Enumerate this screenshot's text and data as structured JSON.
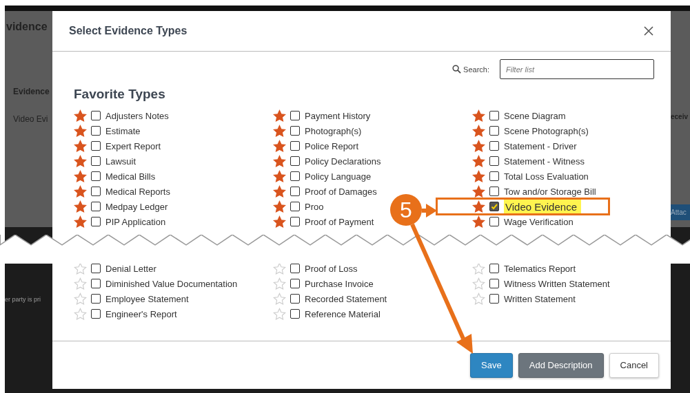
{
  "background": {
    "title": "vidence",
    "column_header": "Evidence",
    "cell": "Video Evi",
    "right_header": "eceiv",
    "right_button": "Attac",
    "note": "er party is pri"
  },
  "dialog": {
    "title": "Select Evidence Types",
    "search": {
      "label": "Search:",
      "placeholder": "Filter list"
    },
    "section_title": "Favorite Types",
    "favorite_columns": [
      [
        {
          "label": "Adjusters Notes",
          "favorite": true,
          "checked": false
        },
        {
          "label": "Estimate",
          "favorite": true,
          "checked": false
        },
        {
          "label": "Expert Report",
          "favorite": true,
          "checked": false
        },
        {
          "label": "Lawsuit",
          "favorite": true,
          "checked": false
        },
        {
          "label": "Medical Bills",
          "favorite": true,
          "checked": false
        },
        {
          "label": "Medical Reports",
          "favorite": true,
          "checked": false
        },
        {
          "label": "Medpay Ledger",
          "favorite": true,
          "checked": false
        },
        {
          "label": "PIP Application",
          "favorite": true,
          "checked": false
        }
      ],
      [
        {
          "label": "Payment History",
          "favorite": true,
          "checked": false
        },
        {
          "label": "Photograph(s)",
          "favorite": true,
          "checked": false
        },
        {
          "label": "Police Report",
          "favorite": true,
          "checked": false
        },
        {
          "label": "Policy Declarations",
          "favorite": true,
          "checked": false
        },
        {
          "label": "Policy Language",
          "favorite": true,
          "checked": false
        },
        {
          "label": "Proof of Damages",
          "favorite": true,
          "checked": false
        },
        {
          "label": "Proo",
          "favorite": true,
          "checked": false
        },
        {
          "label": "Proof of Payment",
          "favorite": true,
          "checked": false
        }
      ],
      [
        {
          "label": "Scene Diagram",
          "favorite": true,
          "checked": false
        },
        {
          "label": "Scene Photograph(s)",
          "favorite": true,
          "checked": false
        },
        {
          "label": "Statement - Driver",
          "favorite": true,
          "checked": false
        },
        {
          "label": "Statement - Witness",
          "favorite": true,
          "checked": false
        },
        {
          "label": "Total Loss Evaluation",
          "favorite": true,
          "checked": false
        },
        {
          "label": "Tow and/or Storage Bill",
          "favorite": true,
          "checked": false
        },
        {
          "label": "Video Evidence",
          "favorite": true,
          "checked": true,
          "highlighted": true
        },
        {
          "label": "Wage Verification",
          "favorite": true,
          "checked": false
        }
      ]
    ],
    "other_columns": [
      [
        {
          "label": "Denial Letter",
          "favorite": false,
          "checked": false
        },
        {
          "label": "Diminished Value Documentation",
          "favorite": false,
          "checked": false
        },
        {
          "label": "Employee Statement",
          "favorite": false,
          "checked": false
        },
        {
          "label": "Engineer's Report",
          "favorite": false,
          "checked": false
        }
      ],
      [
        {
          "label": "Proof of Loss",
          "favorite": false,
          "checked": false
        },
        {
          "label": "Purchase Invoice",
          "favorite": false,
          "checked": false
        },
        {
          "label": "Recorded Statement",
          "favorite": false,
          "checked": false
        },
        {
          "label": "Reference Material",
          "favorite": false,
          "checked": false
        }
      ],
      [
        {
          "label": "Telematics Report",
          "favorite": false,
          "checked": false
        },
        {
          "label": "Witness Written Statement",
          "favorite": false,
          "checked": false
        },
        {
          "label": "Written Statement",
          "favorite": false,
          "checked": false
        }
      ]
    ],
    "buttons": [
      {
        "label": "Save",
        "kind": "primary"
      },
      {
        "label": "Add Description",
        "kind": "secondary"
      },
      {
        "label": "Cancel",
        "kind": "plain"
      }
    ]
  },
  "annotation": {
    "step": "5"
  }
}
